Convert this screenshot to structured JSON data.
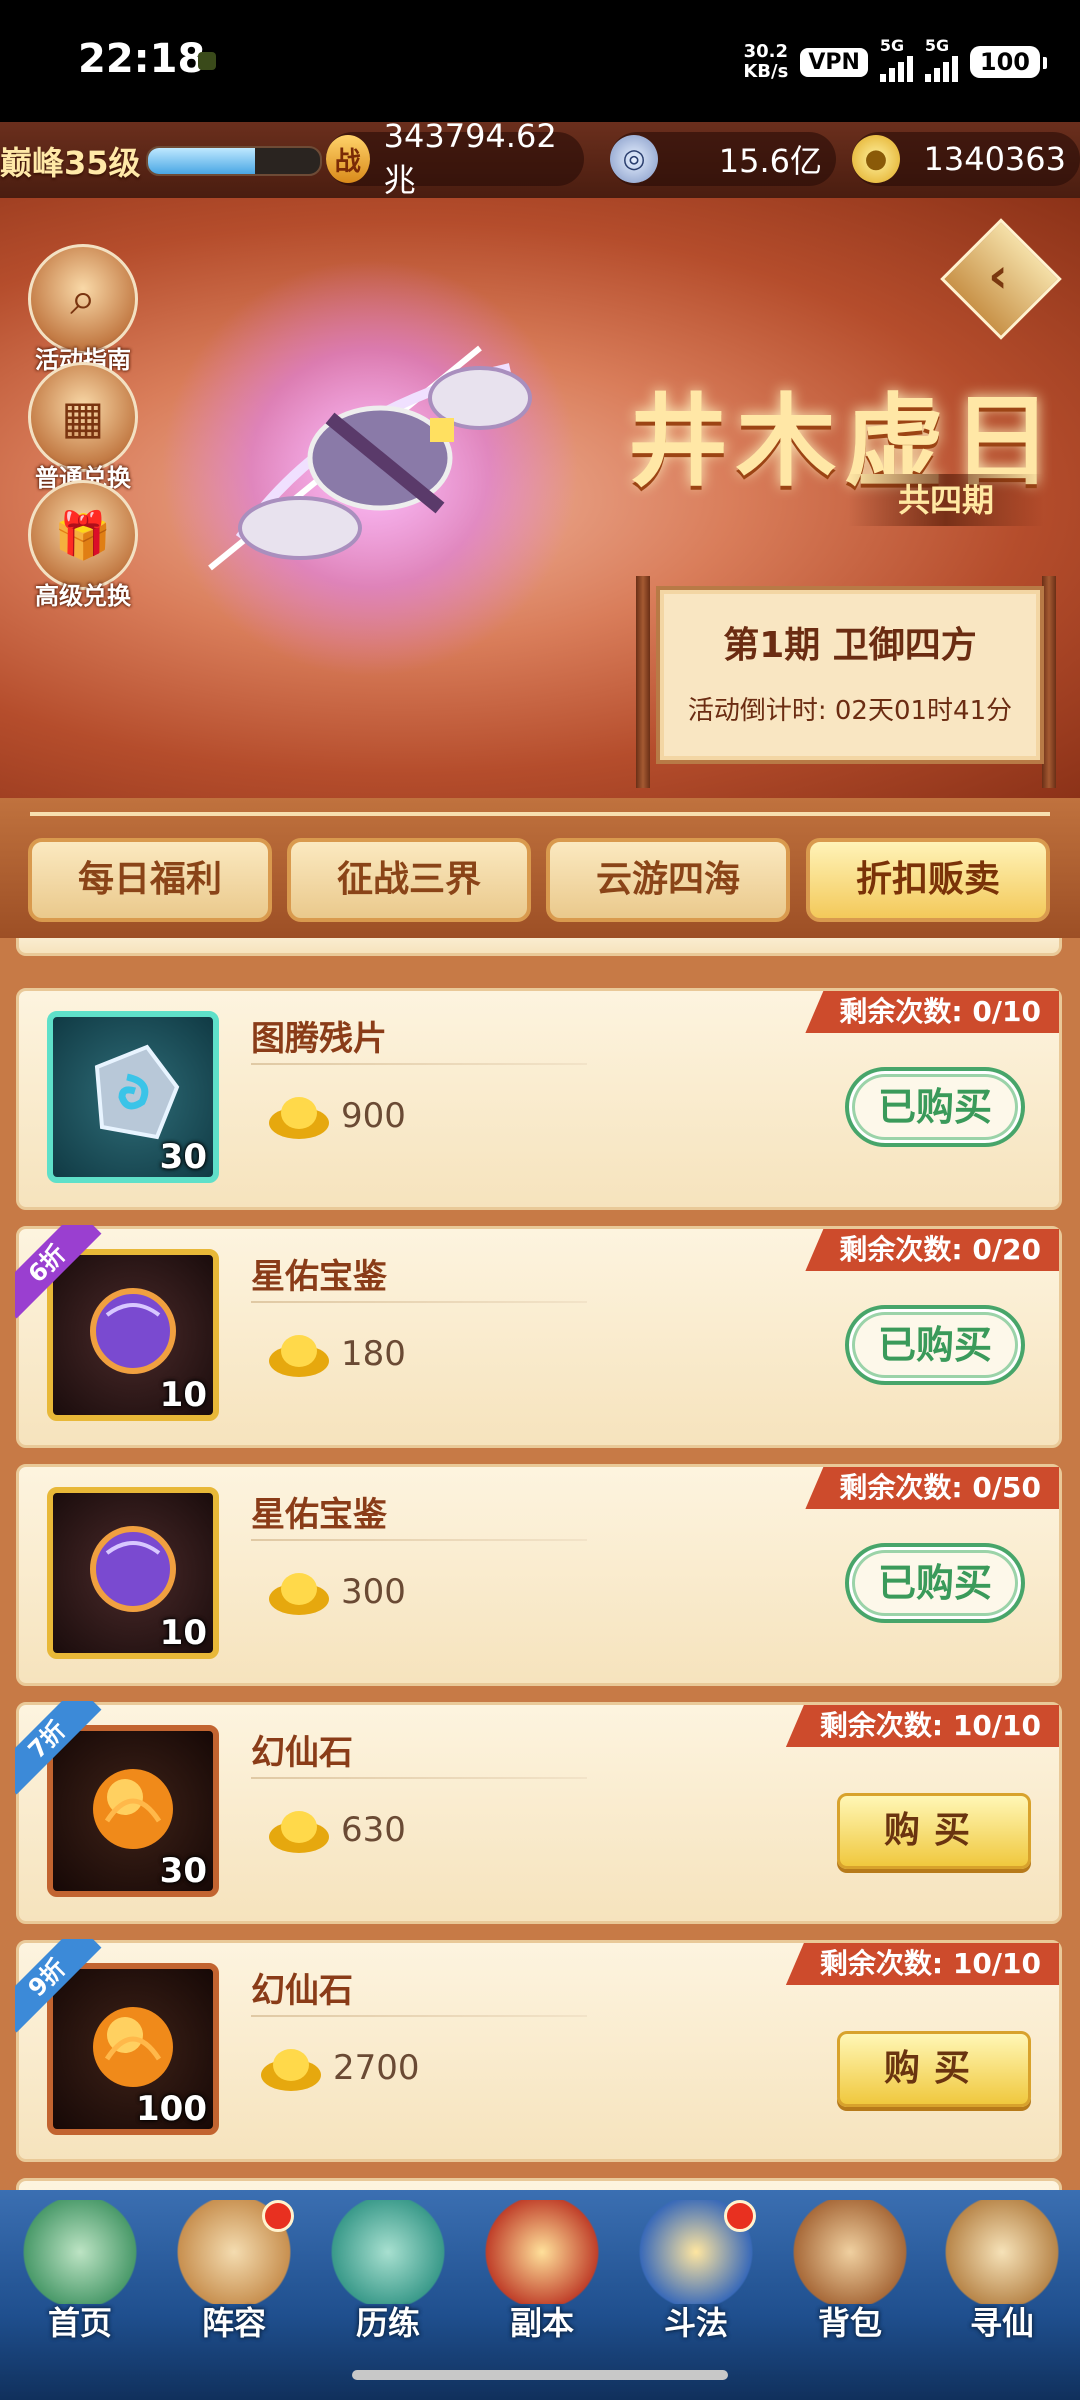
{
  "status_bar": {
    "time": "22:18",
    "speed_value": "30.2",
    "speed_unit": "KB/s",
    "vpn": "VPN",
    "signal1": "5G",
    "signal2": "5G",
    "battery": "100"
  },
  "resources": {
    "level": "巅峰35级",
    "level_progress": 0.62,
    "power_icon": "战",
    "power": "343794.62兆",
    "coins": "15.6亿",
    "ingots": "1340363"
  },
  "banner": {
    "title": "井木虚日",
    "subtitle": "共四期",
    "side_buttons": [
      {
        "label": "活动指南",
        "icon": "magnifier-icon"
      },
      {
        "label": "普通兑换",
        "icon": "box-icon"
      },
      {
        "label": "高级兑换",
        "icon": "gift-icon"
      }
    ],
    "period_title": "第1期  卫御四方",
    "countdown": "活动倒计时: 02天01时41分"
  },
  "tabs": [
    {
      "label": "每日福利",
      "active": false
    },
    {
      "label": "征战三界",
      "active": false
    },
    {
      "label": "云游四海",
      "active": false
    },
    {
      "label": "折扣贩卖",
      "active": true
    }
  ],
  "items": [
    {
      "name": "图腾残片",
      "qty": "30",
      "price": "900",
      "remain": "剩余次数: 0/10",
      "status": "已购买",
      "discount": "",
      "frame": "teal",
      "icon": "totem-shard-icon"
    },
    {
      "name": "星佑宝鉴",
      "qty": "10",
      "price": "180",
      "remain": "剩余次数: 0/20",
      "status": "已购买",
      "discount": "6折",
      "frame": "gold",
      "icon": "star-mirror-icon"
    },
    {
      "name": "星佑宝鉴",
      "qty": "10",
      "price": "300",
      "remain": "剩余次数: 0/50",
      "status": "已购买",
      "discount": "",
      "frame": "gold",
      "icon": "star-mirror-icon"
    },
    {
      "name": "幻仙石",
      "qty": "30",
      "price": "630",
      "remain": "剩余次数: 10/10",
      "status": "购买",
      "discount": "7折",
      "frame": "orange",
      "icon": "fire-stone-icon"
    },
    {
      "name": "幻仙石",
      "qty": "100",
      "price": "2700",
      "remain": "剩余次数: 10/10",
      "status": "购买",
      "discount": "9折",
      "frame": "orange",
      "icon": "fire-stone-icon"
    }
  ],
  "bottom_nav": [
    {
      "label": "首页",
      "badge": false,
      "icon": "mountain-icon"
    },
    {
      "label": "阵容",
      "badge": true,
      "icon": "cards-icon"
    },
    {
      "label": "历练",
      "badge": false,
      "icon": "turtle-icon"
    },
    {
      "label": "副本",
      "badge": false,
      "icon": "gate-icon"
    },
    {
      "label": "斗法",
      "badge": true,
      "icon": "sword-icon"
    },
    {
      "label": "背包",
      "badge": false,
      "icon": "bag-icon"
    },
    {
      "label": "寻仙",
      "badge": false,
      "icon": "scroll-icon"
    }
  ],
  "colors": {
    "accent_red": "#cd4b2c",
    "bought_green": "#3a9a5a",
    "buy_gold": "#f0c83e",
    "nav_blue": "#1f4f8e"
  }
}
